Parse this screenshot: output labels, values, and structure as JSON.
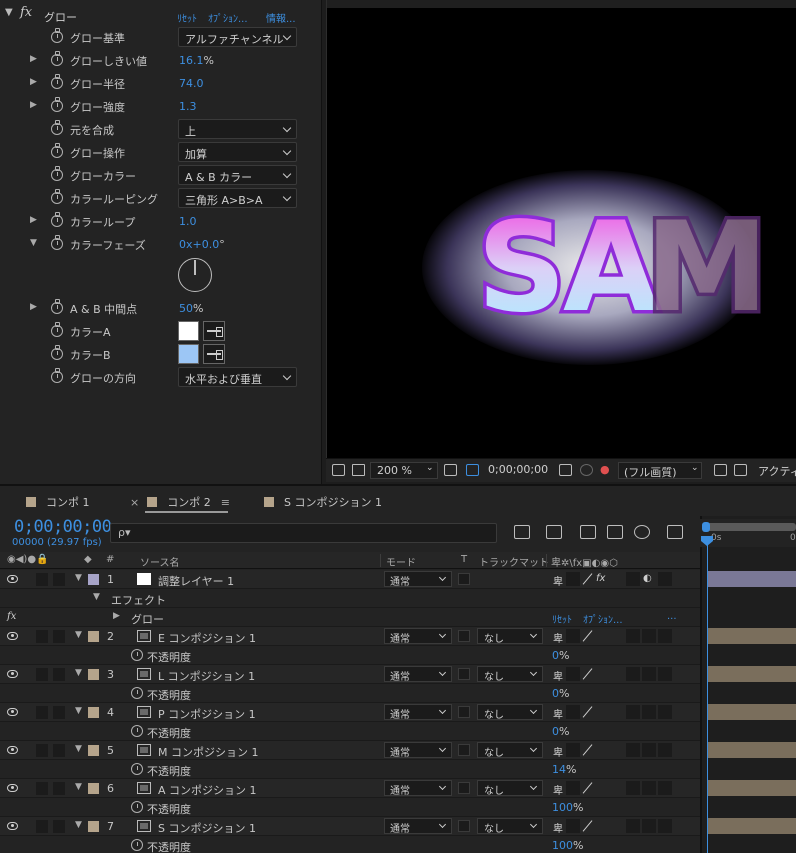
{
  "effect": {
    "name": "グロー",
    "links": {
      "reset": "ﾘｾｯﾄ",
      "options": "ｵﾌﾟｼｮﾝ...",
      "info": "情報..."
    },
    "props": [
      {
        "label": "グロー基準",
        "type": "dropdown",
        "value": "アルファチャンネル",
        "expandable": false
      },
      {
        "label": "グローしきい値",
        "type": "value",
        "value": "16.1",
        "unit": "%",
        "expandable": true
      },
      {
        "label": "グロー半径",
        "type": "value",
        "value": "74.0",
        "unit": "",
        "expandable": true
      },
      {
        "label": "グロー強度",
        "type": "value",
        "value": "1.3",
        "unit": "",
        "expandable": true
      },
      {
        "label": "元を合成",
        "type": "dropdown",
        "value": "上",
        "expandable": false
      },
      {
        "label": "グロー操作",
        "type": "dropdown",
        "value": "加算",
        "expandable": false
      },
      {
        "label": "グローカラー",
        "type": "dropdown",
        "value": "A & B カラー",
        "expandable": false
      },
      {
        "label": "カラールーピング",
        "type": "dropdown",
        "value": "三角形 A>B>A",
        "expandable": false
      },
      {
        "label": "カラーループ",
        "type": "value",
        "value": "1.0",
        "unit": "",
        "expandable": true
      },
      {
        "label": "カラーフェーズ",
        "type": "value",
        "value": "0x+0.0",
        "unit": "°",
        "expandable": true,
        "expanded": true
      },
      {
        "label": "A & B 中間点",
        "type": "value",
        "value": "50",
        "unit": "%",
        "expandable": true
      },
      {
        "label": "カラーA",
        "type": "color",
        "value": "#ffffff",
        "expandable": false
      },
      {
        "label": "カラーB",
        "type": "color",
        "value": "#9cc6f5",
        "expandable": false
      },
      {
        "label": "グローの方向",
        "type": "dropdown",
        "value": "水平および垂直",
        "expandable": false
      }
    ]
  },
  "viewer": {
    "text": [
      "S",
      "A",
      "M"
    ],
    "toolbar": {
      "zoom": "200 %",
      "timecode": "0;00;00;00",
      "quality": "(フル画質)",
      "view": "アクティ"
    }
  },
  "timeline": {
    "tabs": [
      {
        "label": "コンポ 1",
        "active": false
      },
      {
        "label": "コンポ 2",
        "active": true
      },
      {
        "label": "S コンポジション 1",
        "active": false
      }
    ],
    "timecode": "0;00;00;00",
    "fps": "00000 (29.97 fps)",
    "search_glyph": "ρ▾",
    "ruler_label": "0s",
    "columns": {
      "num": "#",
      "source": "ソース名",
      "mode": "モード",
      "t": "T",
      "trackmatte": "トラックマット"
    },
    "adjustment": {
      "num": "1",
      "name": "調整レイヤー 1",
      "mode": "通常",
      "color": "#a7a4c8"
    },
    "effects_group": "エフェクト",
    "glow_row": {
      "name": "グロー",
      "reset": "ﾘｾｯﾄ",
      "options": "ｵﾌﾟｼｮﾝ...",
      "more": "..."
    },
    "layers": [
      {
        "num": "2",
        "name": "E コンポジション 1",
        "mode": "通常",
        "matte": "なし",
        "opacity_label": "不透明度",
        "opacity": "0",
        "unit": "%"
      },
      {
        "num": "3",
        "name": "L コンポジション 1",
        "mode": "通常",
        "matte": "なし",
        "opacity_label": "不透明度",
        "opacity": "0",
        "unit": "%"
      },
      {
        "num": "4",
        "name": "P コンポジション 1",
        "mode": "通常",
        "matte": "なし",
        "opacity_label": "不透明度",
        "opacity": "0",
        "unit": "%"
      },
      {
        "num": "5",
        "name": "M コンポジション 1",
        "mode": "通常",
        "matte": "なし",
        "opacity_label": "不透明度",
        "opacity": "14",
        "unit": "%"
      },
      {
        "num": "6",
        "name": "A コンポジション 1",
        "mode": "通常",
        "matte": "なし",
        "opacity_label": "不透明度",
        "opacity": "100",
        "unit": "%"
      },
      {
        "num": "7",
        "name": "S コンポジション 1",
        "mode": "通常",
        "matte": "なし",
        "opacity_label": "不透明度",
        "opacity": "100",
        "unit": "%"
      }
    ],
    "layer_color": "#b5a48b",
    "accent": "#3d8fe0"
  }
}
